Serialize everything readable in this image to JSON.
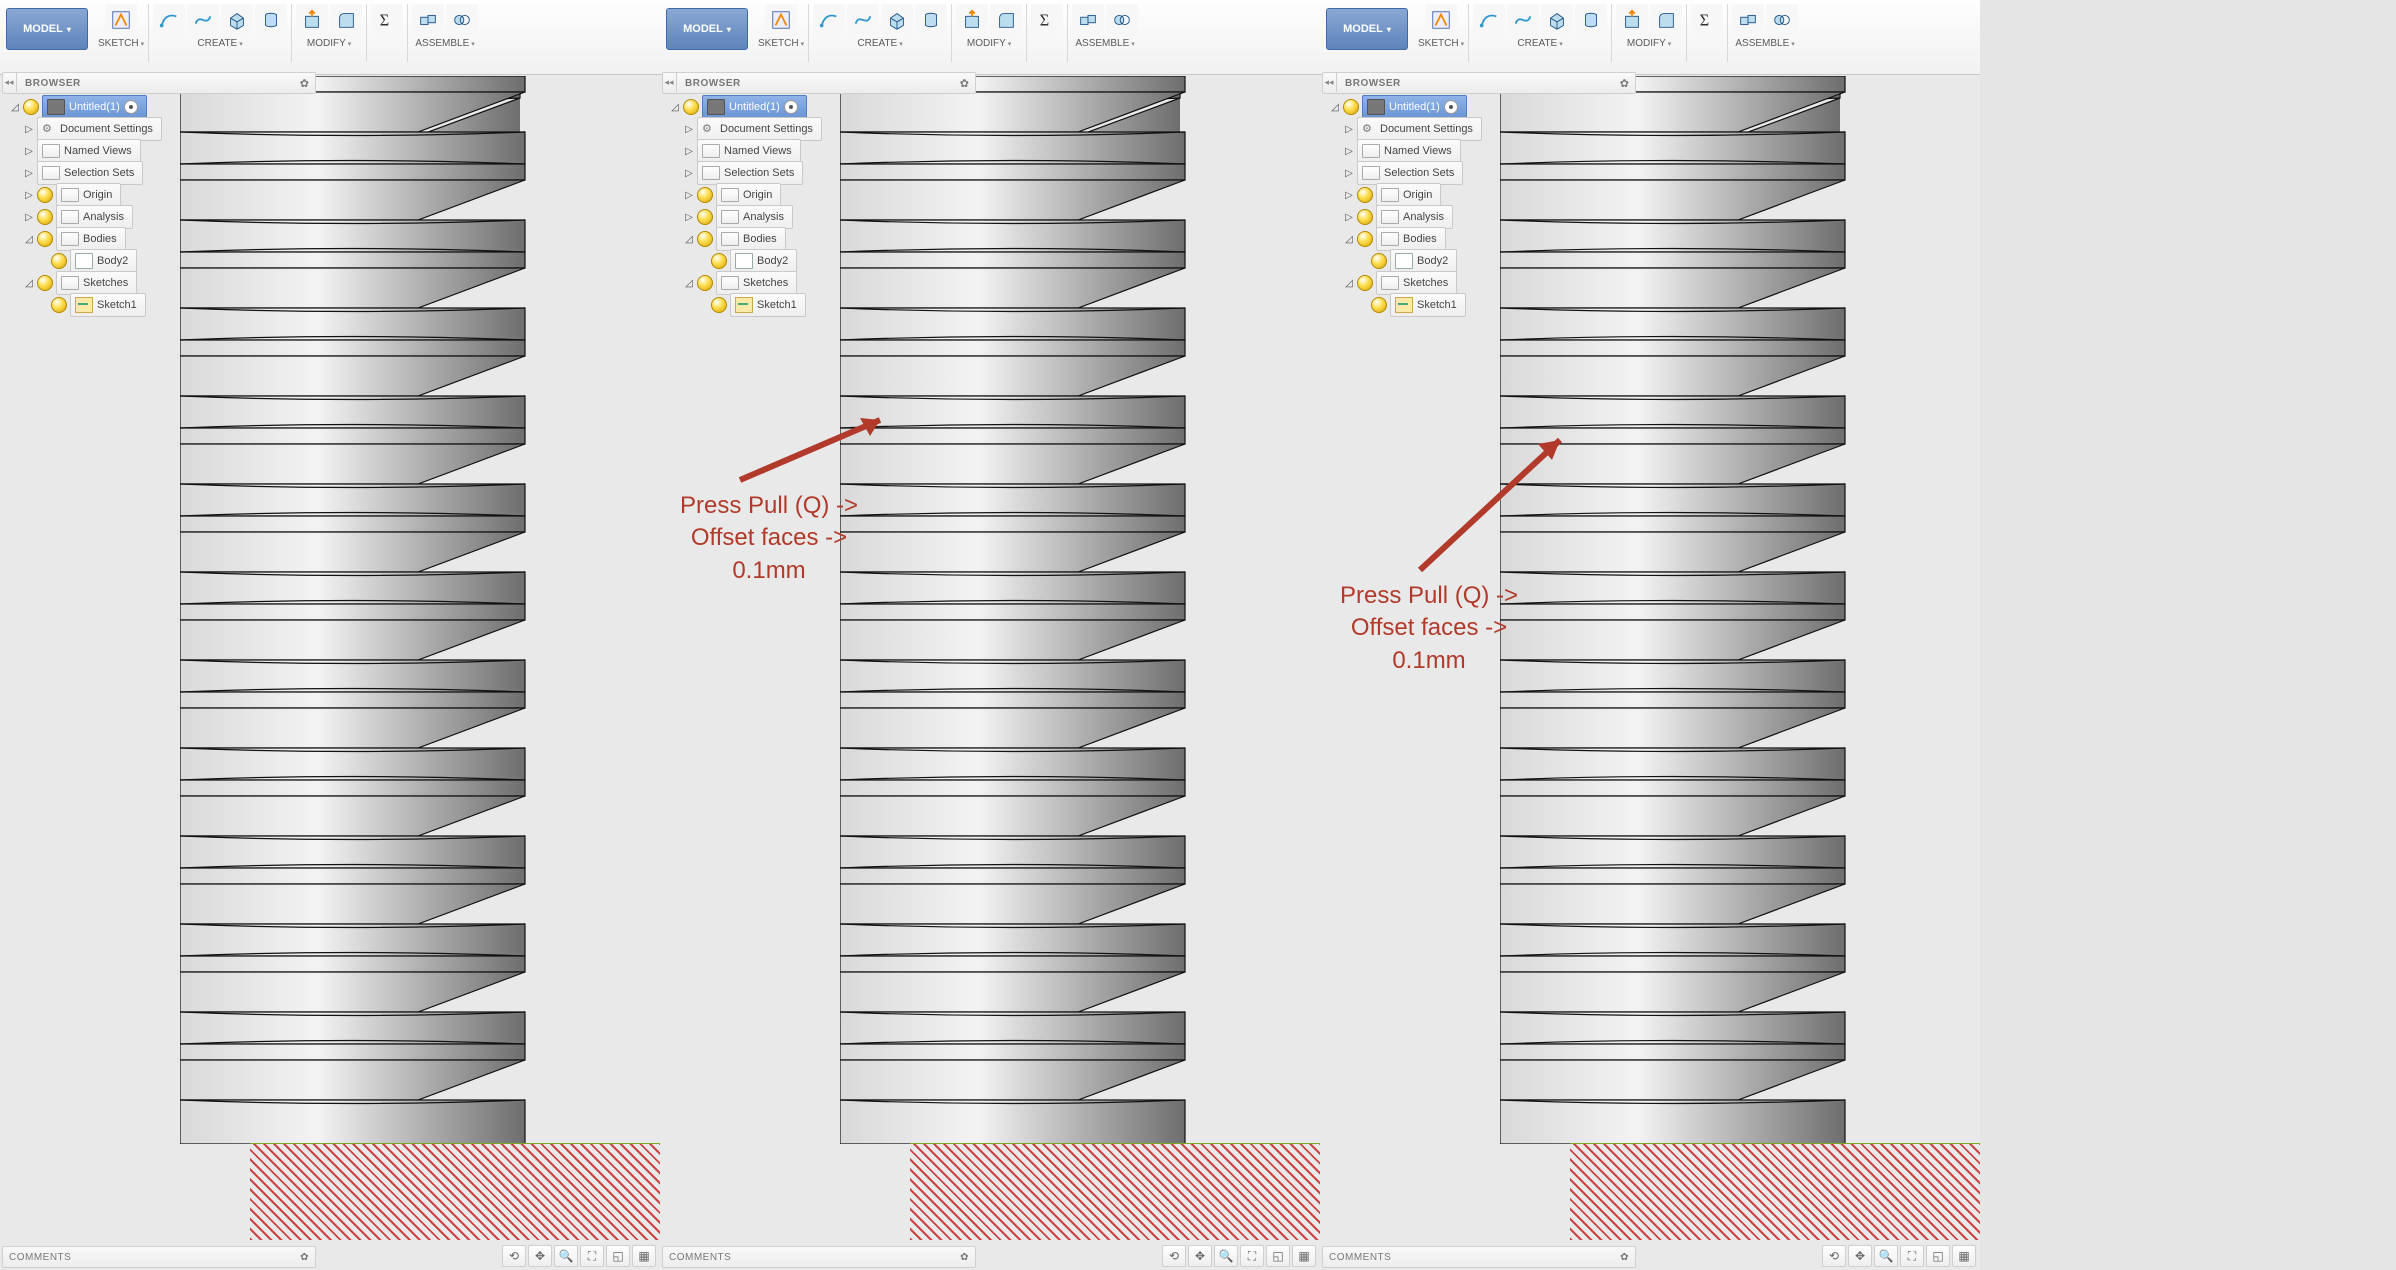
{
  "toolbar": {
    "model": "MODEL",
    "groups": [
      {
        "label": "SKETCH"
      },
      {
        "label": "CREATE"
      },
      {
        "label": "MODIFY"
      },
      {
        "label": ""
      },
      {
        "label": "ASSEMBLE"
      }
    ]
  },
  "browser": {
    "title": "BROWSER"
  },
  "tree": {
    "root": "Untitled(1)",
    "items": [
      "Document Settings",
      "Named Views",
      "Selection Sets",
      "Origin",
      "Analysis",
      "Bodies",
      "Body2",
      "Sketches",
      "Sketch1"
    ]
  },
  "comments": {
    "title": "COMMENTS"
  },
  "annotations": {
    "p2": "Press Pull (Q) ->\nOffset faces ->\n0.1mm",
    "p3": "Press Pull (Q) ->\nOffset faces ->\n0.1mm"
  }
}
